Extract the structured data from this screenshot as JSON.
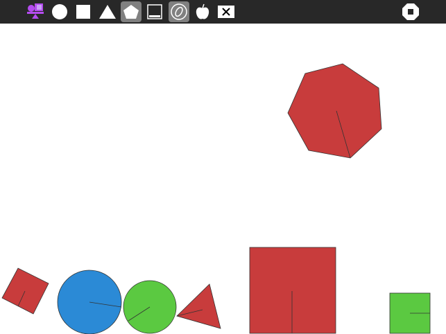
{
  "toolbar": {
    "tools": [
      {
        "name": "activity-icon",
        "active": false
      },
      {
        "name": "circle-tool",
        "active": false
      },
      {
        "name": "box-tool",
        "active": false
      },
      {
        "name": "triangle-tool",
        "active": false
      },
      {
        "name": "polygon-tool",
        "active": true
      },
      {
        "name": "draw-tool",
        "active": false
      },
      {
        "name": "grab-tool",
        "active": true
      },
      {
        "name": "pin-tool",
        "active": false
      },
      {
        "name": "destroy-tool",
        "active": false
      }
    ],
    "stop": "stop-button"
  },
  "colors": {
    "red": "#c83c3c",
    "blue": "#2b8ad6",
    "green": "#5bc941",
    "toolbar": "#282828",
    "accent": "#b54cf0"
  }
}
